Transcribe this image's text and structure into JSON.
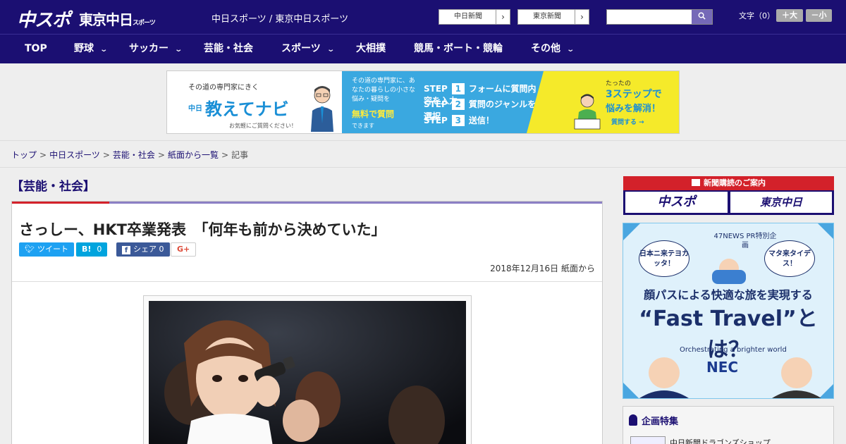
{
  "header": {
    "logo_primary": "中スポ",
    "logo_secondary": "東京中日",
    "logo_secondary_small": "スポーツ",
    "site_title": "中日スポーツ / 東京中日スポーツ",
    "paper_links": [
      {
        "label": "中日新聞"
      },
      {
        "label": "東京新聞"
      }
    ],
    "search_placeholder": "",
    "font_size_label": "文字（0）",
    "font_bigger": "＋大",
    "font_smaller": "－小"
  },
  "nav": {
    "items": [
      {
        "label": "TOP",
        "dropdown": false
      },
      {
        "label": "野球",
        "dropdown": true
      },
      {
        "label": "サッカー",
        "dropdown": true
      },
      {
        "label": "芸能・社会",
        "dropdown": false
      },
      {
        "label": "スポーツ",
        "dropdown": true
      },
      {
        "label": "大相撲",
        "dropdown": false
      },
      {
        "label": "競馬・ボート・競輪",
        "dropdown": false
      },
      {
        "label": "その他",
        "dropdown": true
      }
    ],
    "chevron": "⌄"
  },
  "banner": {
    "tagline": "その道の専門家にきく",
    "brand_prefix": "中日",
    "brand": "教えてナビ",
    "note": "お気軽にご質問ください！",
    "mid_text": "その道の専門家に、あなたの暮らしの小さな悩み・疑問を",
    "mid_highlight": "無料で質問",
    "mid_suffix": "できます",
    "steps": [
      {
        "label": "STEP",
        "num": "1",
        "text": "フォームに質問内容を入力"
      },
      {
        "label": "STEP",
        "num": "2",
        "text": "質問のジャンルを選択"
      },
      {
        "label": "STEP",
        "num": "3",
        "text": "送信！"
      }
    ],
    "right_small": "たったの",
    "right_big": "3ステップで",
    "right_mid": "悩みを解消！",
    "right_cta": "質問する →"
  },
  "breadcrumb": {
    "items": [
      "トップ",
      "中日スポーツ",
      "芸能・社会",
      "紙面から一覧"
    ],
    "current": "記事",
    "sep": ">"
  },
  "article": {
    "category": "【芸能・社会】",
    "headline": "さっしー、HKT卒業発表　「何年も前から決めていた」",
    "share": {
      "tweet": "ツイート",
      "hatena_label": "B!",
      "hatena_count": "0",
      "fb_label": "シェア",
      "fb_count": "0",
      "gplus": "G+"
    },
    "date": "2018年12月16日 紙面から"
  },
  "sidebar": {
    "subscribe_header": "新聞購読のご案内",
    "subscribe_buttons": [
      "中スポ",
      "東京中日"
    ],
    "ad": {
      "tag": "47NEWS PR特別企画",
      "bubble_left": "日本ニ来テヨカッタ！",
      "bubble_right": "マタ来タイデス！",
      "title": "顔パスによる快適な旅を実現する",
      "headline": "“Fast Travel”とは？",
      "slogan": "Orchestrating a brighter world",
      "brand": "NEC"
    },
    "plan": {
      "header": "企画特集",
      "item": "中日新聞ドラゴンズショップ"
    }
  },
  "colors": {
    "brand_navy": "#1b0f72",
    "accent_red": "#d3212a",
    "twitter": "#1da1f2",
    "hatena": "#00a4de",
    "facebook": "#3b5998"
  }
}
